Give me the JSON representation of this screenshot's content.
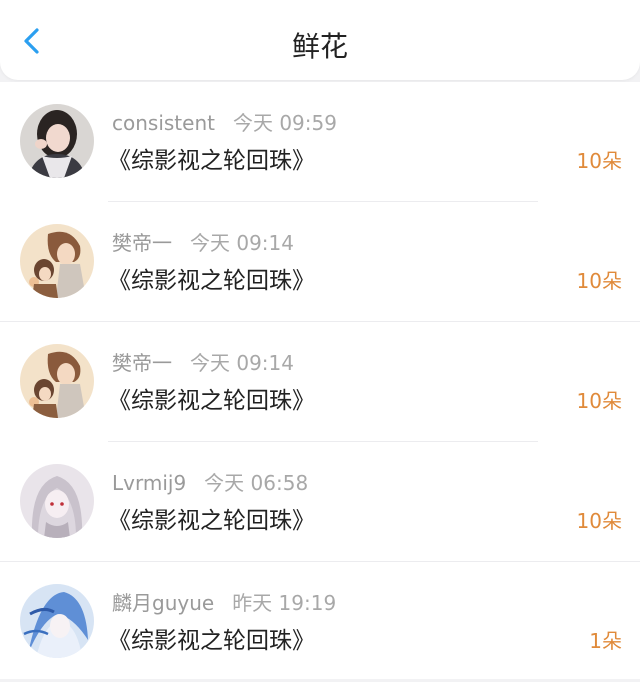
{
  "header": {
    "title": "鲜花",
    "back_icon": "chevron-left-icon",
    "accent_color": "#2b9ff0"
  },
  "colors": {
    "count_color": "#e08a3a"
  },
  "records": [
    {
      "user": "consistent",
      "time": "今天 09:59",
      "book": "《综影视之轮回珠》",
      "count": "10朵"
    },
    {
      "user": "樊帝一",
      "time": "今天 09:14",
      "book": "《综影视之轮回珠》",
      "count": "10朵"
    },
    {
      "user": "樊帝一",
      "time": "今天 09:14",
      "book": "《综影视之轮回珠》",
      "count": "10朵"
    },
    {
      "user": "Lvrmij9",
      "time": "今天 06:58",
      "book": "《综影视之轮回珠》",
      "count": "10朵"
    },
    {
      "user": "麟月guyue",
      "time": "昨天 19:19",
      "book": "《综影视之轮回珠》",
      "count": "1朵"
    }
  ]
}
